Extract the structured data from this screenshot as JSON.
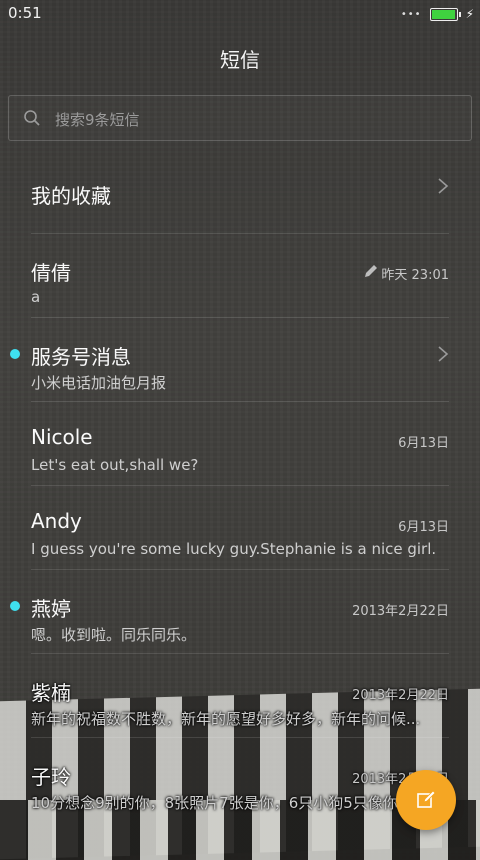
{
  "status_bar": {
    "time": "0:51"
  },
  "header": {
    "title": "短信"
  },
  "search": {
    "placeholder": "搜索9条短信"
  },
  "conversations": [
    {
      "name": "我的收藏",
      "preview": "",
      "date": "",
      "unread": false,
      "chevron": true,
      "draft": false
    },
    {
      "name": "倩倩",
      "preview": "a",
      "date": "昨天 23:01",
      "unread": false,
      "chevron": false,
      "draft": true
    },
    {
      "name": "服务号消息",
      "preview": "小米电话加油包月报",
      "date": "",
      "unread": true,
      "chevron": true,
      "draft": false
    },
    {
      "name": "Nicole",
      "preview": "Let's eat out,shall we?",
      "date": "6月13日",
      "unread": false,
      "chevron": false,
      "draft": false
    },
    {
      "name": "Andy",
      "preview": "I guess you're some lucky guy.Stephanie is a nice girl.",
      "date": "6月13日",
      "unread": false,
      "chevron": false,
      "draft": false
    },
    {
      "name": "燕婷",
      "preview": "嗯。收到啦。同乐同乐。",
      "date": "2013年2月22日",
      "unread": true,
      "chevron": false,
      "draft": false
    },
    {
      "name": "紫楠",
      "preview": "新年的祝福数不胜数，新年的愿望好多好多，新年的问候...",
      "date": "2013年2月22日",
      "unread": false,
      "chevron": false,
      "draft": false
    },
    {
      "name": "子玲",
      "preview": "10分想念9别的你，8张照片7张是你，6只小狗5只像你",
      "date": "2013年2月22日",
      "unread": false,
      "chevron": false,
      "draft": false
    }
  ],
  "fab": {
    "icon": "compose-icon"
  },
  "colors": {
    "accent": "#f5a623",
    "unread": "#3fe0f0",
    "battery": "#3fd23f"
  }
}
